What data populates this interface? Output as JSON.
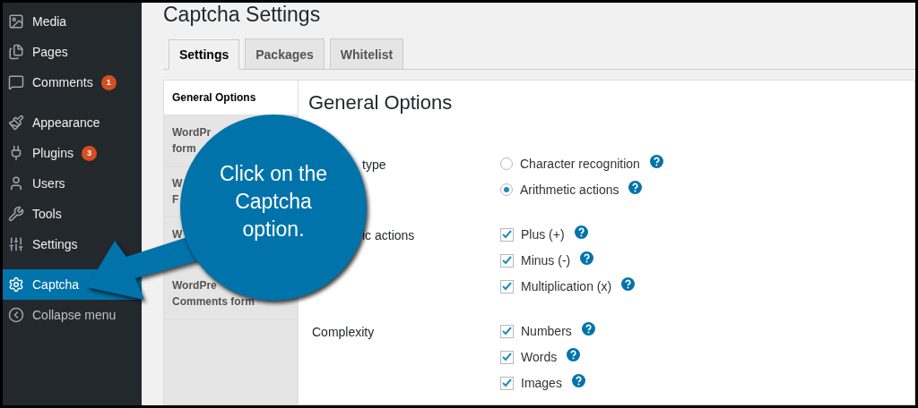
{
  "sidebar": {
    "items": [
      {
        "label": "Media",
        "selected": false
      },
      {
        "label": "Pages",
        "selected": false
      },
      {
        "label": "Comments",
        "badge": "1",
        "selected": false
      },
      {
        "label": "Appearance",
        "selected": false
      },
      {
        "label": "Plugins",
        "badge": "3",
        "selected": false
      },
      {
        "label": "Users",
        "selected": false
      },
      {
        "label": "Tools",
        "selected": false
      },
      {
        "label": "Settings",
        "selected": false
      },
      {
        "label": "Captcha",
        "selected": true
      },
      {
        "label": "Collapse menu",
        "selected": false
      }
    ]
  },
  "page": {
    "title": "Captcha Settings"
  },
  "tabs": [
    {
      "label": "Settings",
      "selected": true
    },
    {
      "label": "Packages",
      "selected": false
    },
    {
      "label": "Whitelist",
      "selected": false
    }
  ],
  "side_tabs": [
    {
      "lines": [
        "General Options"
      ],
      "selected": true
    },
    {
      "lines": [
        "WordPr",
        "form"
      ],
      "selected": false
    },
    {
      "lines": [
        "W",
        "F"
      ],
      "selected": false
    },
    {
      "lines": [
        "W"
      ],
      "selected": false
    },
    {
      "lines": [
        "WordPre",
        "Comments form"
      ],
      "selected": false
    }
  ],
  "panel": {
    "heading": "General Options",
    "groups": [
      {
        "label": "type",
        "options": [
          {
            "kind": "radio",
            "label": "Character recognition",
            "selected": false
          },
          {
            "kind": "radio",
            "label": "Arithmetic actions",
            "selected": true
          }
        ]
      },
      {
        "label": "ic actions",
        "options": [
          {
            "kind": "checkbox",
            "label": "Plus (+)",
            "checked": true
          },
          {
            "kind": "checkbox",
            "label": "Minus (-)",
            "checked": true
          },
          {
            "kind": "checkbox",
            "label": "Multiplication (x)",
            "checked": true
          }
        ]
      },
      {
        "label": "Complexity",
        "options": [
          {
            "kind": "checkbox",
            "label": "Numbers",
            "checked": true
          },
          {
            "kind": "checkbox",
            "label": "Words",
            "checked": true
          },
          {
            "kind": "checkbox",
            "label": "Images",
            "checked": true
          }
        ]
      }
    ]
  },
  "callout": {
    "text": "Click on the Captcha option."
  }
}
